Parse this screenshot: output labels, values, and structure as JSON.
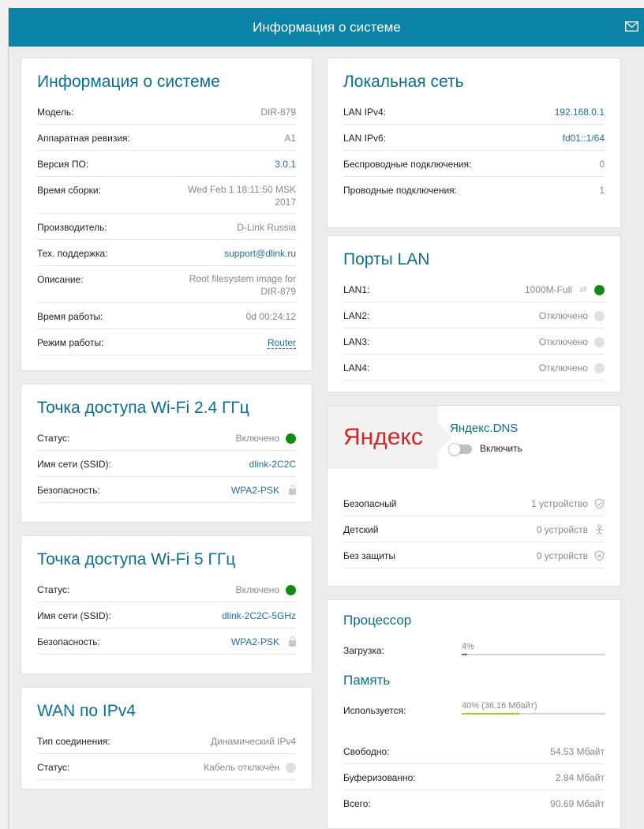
{
  "header": {
    "title": "Информация о системе",
    "mail_icon": "mail-icon"
  },
  "system": {
    "title": "Информация о системе",
    "rows": [
      {
        "label": "Модель:",
        "value": "DIR-879"
      },
      {
        "label": "Аппаратная ревизия:",
        "value": "A1"
      },
      {
        "label": "Версия ПО:",
        "value": "3.0.1"
      },
      {
        "label": "Время сборки:",
        "value_line1": "Wed Feb 1 18:11:50 MSK",
        "value_line2": "2017"
      },
      {
        "label": "Производитель:",
        "value": "D-Link Russia"
      },
      {
        "label": "Тех. поддержка:",
        "value": "support@dlink.ru"
      },
      {
        "label": "Описание:",
        "value_line1": "Root filesystem image for",
        "value_line2": "DIR-879"
      },
      {
        "label": "Время работы:",
        "value": "0d 00:24:12"
      },
      {
        "label": "Режим работы:",
        "value": "Router"
      }
    ]
  },
  "wifi24": {
    "title": "Точка доступа Wi-Fi 2.4 ГГц",
    "rows": [
      {
        "label": "Статус:",
        "value": "Включено"
      },
      {
        "label": "Имя сети (SSID):",
        "value": "dlink-2C2C"
      },
      {
        "label": "Безопасность:",
        "value": "WPA2-PSK"
      }
    ]
  },
  "wifi5": {
    "title": "Точка доступа Wi-Fi 5 ГГц",
    "rows": [
      {
        "label": "Статус:",
        "value": "Включено"
      },
      {
        "label": "Имя сети (SSID):",
        "value": "dlink-2C2C-5GHz"
      },
      {
        "label": "Безопасность:",
        "value": "WPA2-PSK"
      }
    ]
  },
  "wan": {
    "title": "WAN по IPv4",
    "rows": [
      {
        "label": "Тип соединения:",
        "value": "Динамический IPv4"
      },
      {
        "label": "Статус:",
        "value": "Кабель отключён"
      }
    ]
  },
  "lan": {
    "title": "Локальная сеть",
    "rows": [
      {
        "label": "LAN IPv4:",
        "value": "192.168.0.1"
      },
      {
        "label": "LAN IPv6:",
        "value": "fd01::1/64"
      },
      {
        "label": "Беспроводные подключения:",
        "value": "0"
      },
      {
        "label": "Проводные подключения:",
        "value": "1"
      }
    ]
  },
  "ports": {
    "title": "Порты LAN",
    "rows": [
      {
        "label": "LAN1:",
        "value": "1000M-Full"
      },
      {
        "label": "LAN2:",
        "value": "Отключено"
      },
      {
        "label": "LAN3:",
        "value": "Отключено"
      },
      {
        "label": "LAN4:",
        "value": "Отключено"
      }
    ]
  },
  "yandex": {
    "logo": "Яндекс",
    "title": "Яндекс.DNS",
    "toggle_label": "Включить",
    "toggle_on": false,
    "rows": [
      {
        "label": "Безопасный",
        "value": "1 устройство"
      },
      {
        "label": "Детский",
        "value": "0 устройств"
      },
      {
        "label": "Без защиты",
        "value": "0 устройств"
      }
    ]
  },
  "cpu": {
    "title": "Процессор",
    "load_label": "Загрузка:",
    "load_value": "4%",
    "load_fraction": 0.04,
    "load_color": "#2ca02c"
  },
  "memory": {
    "title": "Память",
    "used_label": "Используется:",
    "used_value": "40% (36.16 Мбайт)",
    "used_fraction": 0.4,
    "used_color": "#a8c92a",
    "rows": [
      {
        "label": "Свободно:",
        "value": "54.53 Мбайт"
      },
      {
        "label": "Буферизованно:",
        "value": "2.84 Мбайт"
      },
      {
        "label": "Всего:",
        "value": "90.69 Мбайт"
      }
    ]
  },
  "colors": {
    "header": "#0b83a6",
    "title": "#0b6f8f",
    "link": "#1e6fa0",
    "status_on": "#138a13",
    "status_off": "#e0e0e0"
  }
}
